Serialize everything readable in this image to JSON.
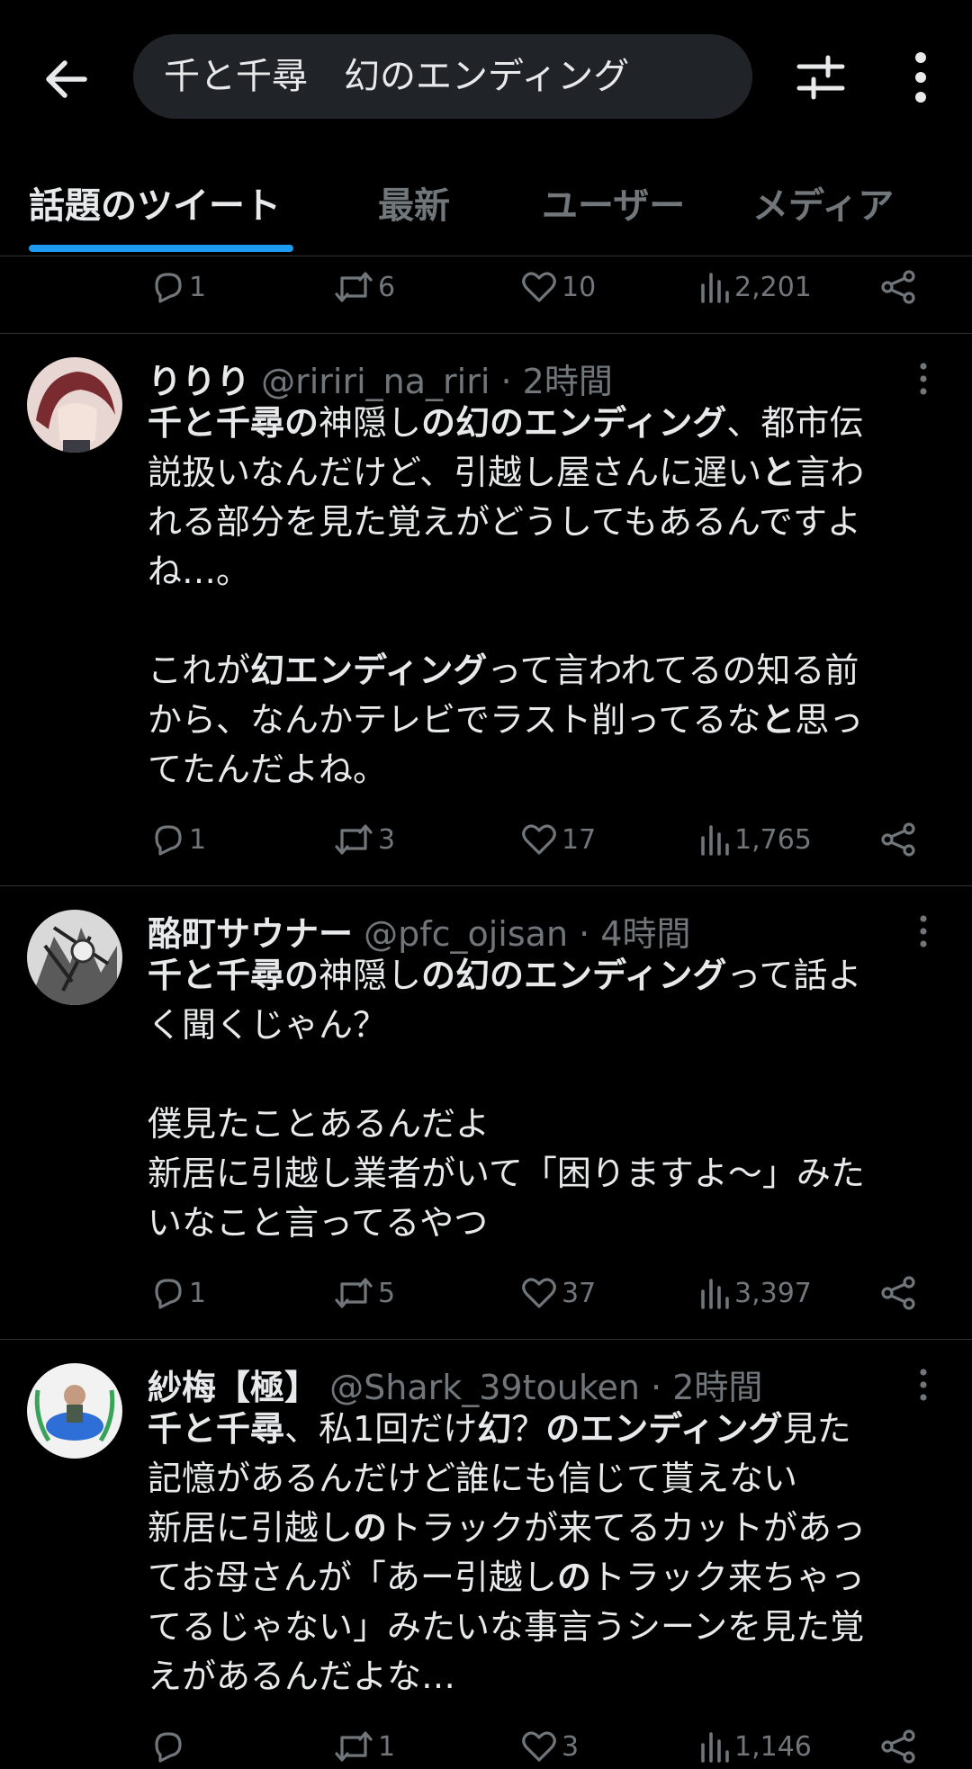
{
  "search": {
    "query": "千と千尋　幻のエンディング"
  },
  "tabs": [
    {
      "label": "話題のツイート",
      "active": true
    },
    {
      "label": "最新"
    },
    {
      "label": "ユーザー"
    },
    {
      "label": "メディア"
    }
  ],
  "top_actions": {
    "replies": "1",
    "retweets": "6",
    "likes": "10",
    "views": "2,201"
  },
  "tweets": [
    {
      "name": "りりり",
      "handle": "@ririri_na_riri",
      "time": "2時間",
      "segments": [
        {
          "t": "千と千尋の",
          "b": true
        },
        {
          "t": "神隠し",
          "b": false
        },
        {
          "t": "の幻のエンディング",
          "b": true
        },
        {
          "t": "、都市伝説扱いなんだけど、引越し屋さんに遅い",
          "b": false
        },
        {
          "t": "と",
          "b": true
        },
        {
          "t": "言われる部分を見た覚えがどうしてもあるんですよね…。\n\nこれが",
          "b": false
        },
        {
          "t": "幻エンディング",
          "b": true
        },
        {
          "t": "って言われてるの知る前から、なんかテレビでラスト削ってるな",
          "b": false
        },
        {
          "t": "と",
          "b": true
        },
        {
          "t": "思ってたんだよね。",
          "b": false
        }
      ],
      "lines": [
        [
          {
            "t": "千と千尋の",
            "b": true
          },
          {
            "t": "神隠し",
            "b": false
          },
          {
            "t": "の幻のエンディング",
            "b": true
          },
          {
            "t": "、都市伝",
            "b": false
          }
        ],
        [
          {
            "t": "説扱いなんだけど、引越し屋さんに遅い",
            "b": false
          },
          {
            "t": "と",
            "b": true
          },
          {
            "t": "言わ",
            "b": false
          }
        ],
        [
          {
            "t": "れる部分を見た覚えがどうしてもあるんですよ",
            "b": false
          }
        ],
        [
          {
            "t": "ね…。",
            "b": false
          }
        ],
        [],
        [
          {
            "t": "これが",
            "b": false
          },
          {
            "t": "幻エンディング",
            "b": true
          },
          {
            "t": "って言われてるの知る前",
            "b": false
          }
        ],
        [
          {
            "t": "から、なんかテレビでラスト削ってるな",
            "b": false
          },
          {
            "t": "と",
            "b": true
          },
          {
            "t": "思っ",
            "b": false
          }
        ],
        [
          {
            "t": "てたんだよね。",
            "b": false
          }
        ]
      ],
      "actions": {
        "replies": "1",
        "retweets": "3",
        "likes": "17",
        "views": "1,765"
      }
    },
    {
      "name": "酪町サウナー",
      "handle": "@pfc_ojisan",
      "time": "4時間",
      "lines": [
        [
          {
            "t": "千と千尋の",
            "b": true
          },
          {
            "t": "神隠し",
            "b": false
          },
          {
            "t": "の幻のエンディング",
            "b": true
          },
          {
            "t": "って話よ",
            "b": false
          }
        ],
        [
          {
            "t": "く聞くじゃん？",
            "b": false
          }
        ],
        [],
        [
          {
            "t": "僕見たことあるんだよ",
            "b": false
          }
        ],
        [
          {
            "t": "新居に引越し業者がいて「困りますよ〜」みた",
            "b": false
          }
        ],
        [
          {
            "t": "いなこと言ってるやつ",
            "b": false
          }
        ]
      ],
      "actions": {
        "replies": "1",
        "retweets": "5",
        "likes": "37",
        "views": "3,397"
      }
    },
    {
      "name": "紗梅【極】",
      "handle": "@Shark_39touken",
      "time": "2時間",
      "lines": [
        [
          {
            "t": "千と千尋",
            "b": true
          },
          {
            "t": "、私1回だけ",
            "b": false
          },
          {
            "t": "幻",
            "b": true
          },
          {
            "t": "？",
            "b": false
          },
          {
            "t": "のエンディング",
            "b": true
          },
          {
            "t": "見た",
            "b": false
          }
        ],
        [
          {
            "t": "記憶があるんだけど誰にも信じて貰えない",
            "b": false
          }
        ],
        [
          {
            "t": "新居に引越し",
            "b": false
          },
          {
            "t": "の",
            "b": true
          },
          {
            "t": "トラックが来てるカットがあっ",
            "b": false
          }
        ],
        [
          {
            "t": "てお母さんが「あー引越し",
            "b": false
          },
          {
            "t": "の",
            "b": true
          },
          {
            "t": "トラック来ちゃっ",
            "b": false
          }
        ],
        [
          {
            "t": "てるじゃない」みたいな事言うシーンを見た覚",
            "b": false
          }
        ],
        [
          {
            "t": "えがあるんだよな…",
            "b": false
          }
        ]
      ],
      "actions": {
        "replies": "",
        "retweets": "1",
        "likes": "3",
        "views": "1,146"
      }
    }
  ],
  "colors": {
    "accent": "#1d9bf0",
    "muted": "#71767b",
    "text": "#e7e9ea",
    "background": "#000000"
  }
}
